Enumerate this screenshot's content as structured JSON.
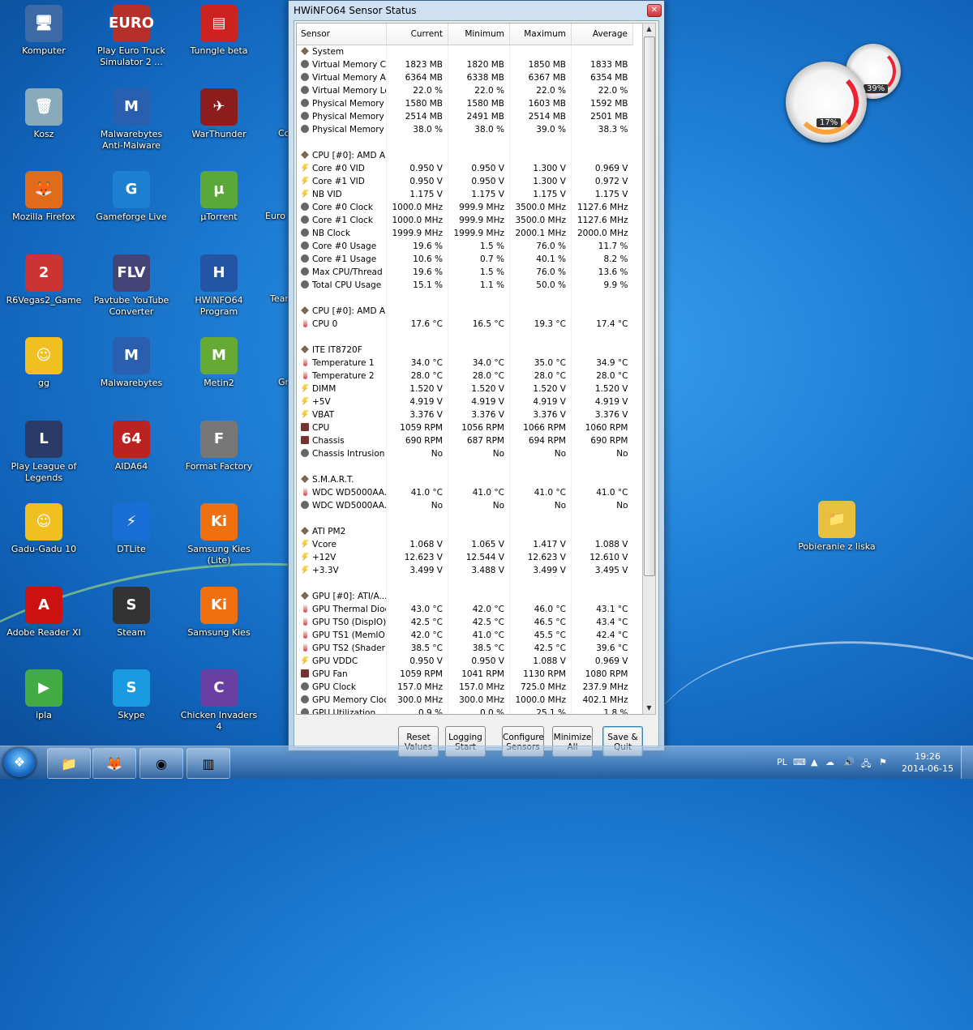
{
  "desktop": {
    "icons": [
      {
        "label": "Komputer",
        "glyph": "🖥"
      },
      {
        "label": "Play Euro Truck Simulator 2 ...",
        "glyph": "EURO"
      },
      {
        "label": "Tunngle beta",
        "glyph": "▤"
      },
      {
        "label": "Kosz",
        "glyph": "🗑"
      },
      {
        "label": "Malwarebytes Anti-Malware",
        "glyph": "M"
      },
      {
        "label": "WarThunder",
        "glyph": "✈"
      },
      {
        "label": "Mozilla Firefox",
        "glyph": "🦊"
      },
      {
        "label": "Gameforge Live",
        "glyph": "G"
      },
      {
        "label": "µTorrent",
        "glyph": "µ"
      },
      {
        "label": "R6Vegas2_Game",
        "glyph": "2"
      },
      {
        "label": "Pavtube YouTube Converter",
        "glyph": "FLV"
      },
      {
        "label": "HWiNFO64 Program",
        "glyph": "H"
      },
      {
        "label": "gg",
        "glyph": "☺"
      },
      {
        "label": "Malwarebytes",
        "glyph": "M"
      },
      {
        "label": "Metin2",
        "glyph": "M"
      },
      {
        "label": "Play League of Legends",
        "glyph": "L"
      },
      {
        "label": "AIDA64",
        "glyph": "64"
      },
      {
        "label": "Format Factory",
        "glyph": "F"
      },
      {
        "label": "Gadu-Gadu 10",
        "glyph": "☺"
      },
      {
        "label": "DTLite",
        "glyph": "⚡"
      },
      {
        "label": "Samsung Kies (Lite)",
        "glyph": "Ki"
      },
      {
        "label": "Adobe Reader XI",
        "glyph": "A"
      },
      {
        "label": "Steam",
        "glyph": "S"
      },
      {
        "label": "Samsung Kies",
        "glyph": "Ki"
      },
      {
        "label": "ipla",
        "glyph": "▶"
      },
      {
        "label": "Skype",
        "glyph": "S"
      },
      {
        "label": "Chicken Invaders 4",
        "glyph": "C"
      },
      {
        "label": "Pobieranie z liska",
        "glyph": "📁"
      }
    ],
    "partial_labels": [
      "Co",
      "Euro",
      "Tear",
      "Gr"
    ]
  },
  "gadget": {
    "cpu_percent": "17%",
    "memory_percent": "39%"
  },
  "window": {
    "title": "HWiNFO64 Sensor Status",
    "close_glyph": "✕",
    "columns": [
      "Sensor",
      "Current",
      "Minimum",
      "Maximum",
      "Average"
    ],
    "rows": [
      {
        "type": "group",
        "name": "System"
      },
      {
        "type": "row",
        "icon": "gen",
        "name": "Virtual Memory C...",
        "v": [
          "1823 MB",
          "1820 MB",
          "1850 MB",
          "1833 MB"
        ]
      },
      {
        "type": "row",
        "icon": "gen",
        "name": "Virtual Memory A...",
        "v": [
          "6364 MB",
          "6338 MB",
          "6367 MB",
          "6354 MB"
        ]
      },
      {
        "type": "row",
        "icon": "gen",
        "name": "Virtual Memory Load",
        "v": [
          "22.0 %",
          "22.0 %",
          "22.0 %",
          "22.0 %"
        ]
      },
      {
        "type": "row",
        "icon": "gen",
        "name": "Physical Memory ...",
        "v": [
          "1580 MB",
          "1580 MB",
          "1603 MB",
          "1592 MB"
        ]
      },
      {
        "type": "row",
        "icon": "gen",
        "name": "Physical Memory ...",
        "v": [
          "2514 MB",
          "2491 MB",
          "2514 MB",
          "2501 MB"
        ]
      },
      {
        "type": "row",
        "icon": "gen",
        "name": "Physical Memory ...",
        "v": [
          "38.0 %",
          "38.0 %",
          "39.0 %",
          "38.3 %"
        ]
      },
      {
        "type": "sep"
      },
      {
        "type": "group",
        "name": "CPU [#0]: AMD A..."
      },
      {
        "type": "row",
        "icon": "volt",
        "name": "Core #0 VID",
        "v": [
          "0.950 V",
          "0.950 V",
          "1.300 V",
          "0.969 V"
        ]
      },
      {
        "type": "row",
        "icon": "volt",
        "name": "Core #1 VID",
        "v": [
          "0.950 V",
          "0.950 V",
          "1.300 V",
          "0.972 V"
        ]
      },
      {
        "type": "row",
        "icon": "volt",
        "name": "NB VID",
        "v": [
          "1.175 V",
          "1.175 V",
          "1.175 V",
          "1.175 V"
        ]
      },
      {
        "type": "row",
        "icon": "gen",
        "name": "Core #0 Clock",
        "v": [
          "1000.0 MHz",
          "999.9 MHz",
          "3500.0 MHz",
          "1127.6 MHz"
        ]
      },
      {
        "type": "row",
        "icon": "gen",
        "name": "Core #1 Clock",
        "v": [
          "1000.0 MHz",
          "999.9 MHz",
          "3500.0 MHz",
          "1127.6 MHz"
        ]
      },
      {
        "type": "row",
        "icon": "gen",
        "name": "NB Clock",
        "v": [
          "1999.9 MHz",
          "1999.9 MHz",
          "2000.1 MHz",
          "2000.0 MHz"
        ]
      },
      {
        "type": "row",
        "icon": "gen",
        "name": "Core #0 Usage",
        "v": [
          "19.6 %",
          "1.5 %",
          "76.0 %",
          "11.7 %"
        ]
      },
      {
        "type": "row",
        "icon": "gen",
        "name": "Core #1 Usage",
        "v": [
          "10.6 %",
          "0.7 %",
          "40.1 %",
          "8.2 %"
        ]
      },
      {
        "type": "row",
        "icon": "gen",
        "name": "Max CPU/Thread ...",
        "v": [
          "19.6 %",
          "1.5 %",
          "76.0 %",
          "13.6 %"
        ]
      },
      {
        "type": "row",
        "icon": "gen",
        "name": "Total CPU Usage",
        "v": [
          "15.1 %",
          "1.1 %",
          "50.0 %",
          "9.9 %"
        ]
      },
      {
        "type": "sep"
      },
      {
        "type": "group",
        "name": "CPU [#0]: AMD A..."
      },
      {
        "type": "row",
        "icon": "temp",
        "name": "CPU 0",
        "v": [
          "17.6 °C",
          "16.5 °C",
          "19.3 °C",
          "17.4 °C"
        ]
      },
      {
        "type": "sep"
      },
      {
        "type": "group",
        "name": "ITE IT8720F"
      },
      {
        "type": "row",
        "icon": "temp",
        "name": "Temperature 1",
        "v": [
          "34.0 °C",
          "34.0 °C",
          "35.0 °C",
          "34.9 °C"
        ]
      },
      {
        "type": "row",
        "icon": "temp",
        "name": "Temperature 2",
        "v": [
          "28.0 °C",
          "28.0 °C",
          "28.0 °C",
          "28.0 °C"
        ]
      },
      {
        "type": "row",
        "icon": "volt",
        "name": "DIMM",
        "v": [
          "1.520 V",
          "1.520 V",
          "1.520 V",
          "1.520 V"
        ]
      },
      {
        "type": "row",
        "icon": "volt",
        "name": "+5V",
        "v": [
          "4.919 V",
          "4.919 V",
          "4.919 V",
          "4.919 V"
        ]
      },
      {
        "type": "row",
        "icon": "volt",
        "name": "VBAT",
        "v": [
          "3.376 V",
          "3.376 V",
          "3.376 V",
          "3.376 V"
        ]
      },
      {
        "type": "row",
        "icon": "fan",
        "name": "CPU",
        "v": [
          "1059 RPM",
          "1056 RPM",
          "1066 RPM",
          "1060 RPM"
        ]
      },
      {
        "type": "row",
        "icon": "fan",
        "name": "Chassis",
        "v": [
          "690 RPM",
          "687 RPM",
          "694 RPM",
          "690 RPM"
        ]
      },
      {
        "type": "row",
        "icon": "gen",
        "name": "Chassis Intrusion",
        "v": [
          "No",
          "No",
          "No",
          "No"
        ]
      },
      {
        "type": "sep"
      },
      {
        "type": "group",
        "name": "S.M.A.R.T."
      },
      {
        "type": "row",
        "icon": "temp",
        "name": "WDC WD5000AA...",
        "v": [
          "41.0 °C",
          "41.0 °C",
          "41.0 °C",
          "41.0 °C"
        ]
      },
      {
        "type": "row",
        "icon": "gen",
        "name": "WDC WD5000AA...",
        "v": [
          "No",
          "No",
          "No",
          "No"
        ]
      },
      {
        "type": "sep"
      },
      {
        "type": "group",
        "name": "ATI PM2"
      },
      {
        "type": "row",
        "icon": "volt",
        "name": "Vcore",
        "v": [
          "1.068 V",
          "1.065 V",
          "1.417 V",
          "1.088 V"
        ]
      },
      {
        "type": "row",
        "icon": "volt",
        "name": "+12V",
        "v": [
          "12.623 V",
          "12.544 V",
          "12.623 V",
          "12.610 V"
        ]
      },
      {
        "type": "row",
        "icon": "volt",
        "name": "+3.3V",
        "v": [
          "3.499 V",
          "3.488 V",
          "3.499 V",
          "3.495 V"
        ]
      },
      {
        "type": "sep"
      },
      {
        "type": "group",
        "name": "GPU [#0]: ATI/A..."
      },
      {
        "type": "row",
        "icon": "temp",
        "name": "GPU Thermal Diode",
        "v": [
          "43.0 °C",
          "42.0 °C",
          "46.0 °C",
          "43.1 °C"
        ]
      },
      {
        "type": "row",
        "icon": "temp",
        "name": "GPU TS0 (DispIO)",
        "v": [
          "42.5 °C",
          "42.5 °C",
          "46.5 °C",
          "43.4 °C"
        ]
      },
      {
        "type": "row",
        "icon": "temp",
        "name": "GPU TS1 (MemIO)",
        "v": [
          "42.0 °C",
          "41.0 °C",
          "45.5 °C",
          "42.4 °C"
        ]
      },
      {
        "type": "row",
        "icon": "temp",
        "name": "GPU TS2 (Shader)",
        "v": [
          "38.5 °C",
          "38.5 °C",
          "42.5 °C",
          "39.6 °C"
        ]
      },
      {
        "type": "row",
        "icon": "volt",
        "name": "GPU VDDC",
        "v": [
          "0.950 V",
          "0.950 V",
          "1.088 V",
          "0.969 V"
        ]
      },
      {
        "type": "row",
        "icon": "fan",
        "name": "GPU Fan",
        "v": [
          "1059 RPM",
          "1041 RPM",
          "1130 RPM",
          "1080 RPM"
        ]
      },
      {
        "type": "row",
        "icon": "gen",
        "name": "GPU Clock",
        "v": [
          "157.0 MHz",
          "157.0 MHz",
          "725.0 MHz",
          "237.9 MHz"
        ]
      },
      {
        "type": "row",
        "icon": "gen",
        "name": "GPU Memory Clock",
        "v": [
          "300.0 MHz",
          "300.0 MHz",
          "1000.0 MHz",
          "402.1 MHz"
        ]
      },
      {
        "type": "row",
        "icon": "gen",
        "name": "GPU Utilization",
        "v": [
          "0.9 %",
          "0.0 %",
          "25.1 %",
          "1.8 %"
        ]
      }
    ],
    "buttons": [
      {
        "label": "Reset Values",
        "name": "reset-values-button"
      },
      {
        "label": "Logging Start",
        "name": "logging-start-button"
      },
      {
        "label": "Configure Sensors",
        "name": "configure-sensors-button"
      },
      {
        "label": "Minimize All",
        "name": "minimize-all-button"
      },
      {
        "label": "Save & Quit",
        "name": "save-quit-button"
      }
    ]
  },
  "taskbar": {
    "apps": [
      {
        "name": "explorer",
        "glyph": "📁"
      },
      {
        "name": "firefox",
        "glyph": "🦊"
      },
      {
        "name": "media",
        "glyph": "◉"
      },
      {
        "name": "hwinfo",
        "glyph": "▥"
      }
    ],
    "tray": {
      "language": "PL"
    },
    "clock": {
      "time": "19:26",
      "date": "2014-06-15"
    }
  }
}
